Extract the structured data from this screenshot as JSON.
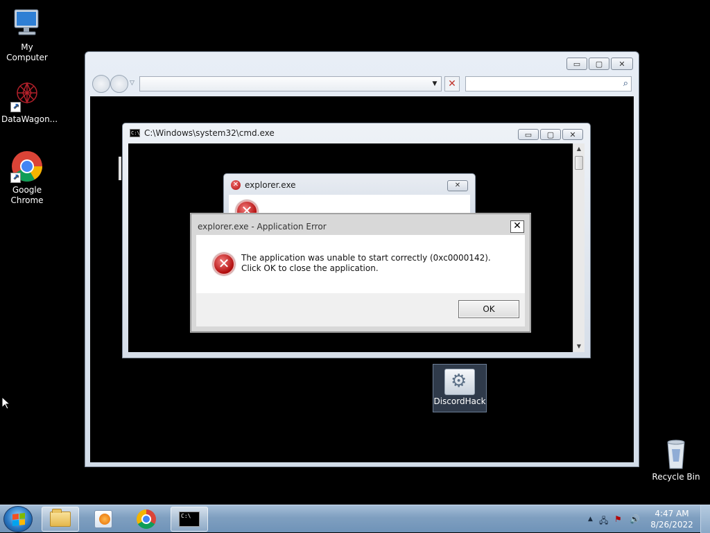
{
  "desktop": {
    "icons": [
      {
        "label": "My Computer",
        "icon": "computer-icon"
      },
      {
        "label": "DataWagon...",
        "icon": "datawagon-icon"
      },
      {
        "label": "Google Chrome",
        "icon": "chrome-icon"
      },
      {
        "label": "DiscordHack",
        "icon": "gear-app-icon"
      },
      {
        "label": "Recycle Bin",
        "icon": "recycle-bin-icon"
      }
    ]
  },
  "explorer": {
    "address_value": "",
    "search_placeholder": "",
    "buttons": {
      "minimize": "▭",
      "maximize": "▢",
      "close": "✕"
    }
  },
  "cmd": {
    "title": "C:\\Windows\\system32\\cmd.exe",
    "icon_text": "C:\\"
  },
  "background_dialog": {
    "title": "explorer.exe"
  },
  "app_error": {
    "title": "explorer.exe - Application Error",
    "message": "The application was unable to start correctly (0xc0000142). Click OK to close the application.",
    "ok_label": "OK",
    "close_glyph": "✕"
  },
  "taskbar": {
    "pinned": [
      "windows-explorer",
      "windows-media-player",
      "google-chrome",
      "command-prompt"
    ],
    "active": "windows-explorer",
    "clock_time": "4:47 AM",
    "clock_date": "8/26/2022"
  },
  "colors": {
    "desktop_bg": "#000000",
    "taskbar": "#7f9fc0",
    "error_red": "#b21010"
  }
}
